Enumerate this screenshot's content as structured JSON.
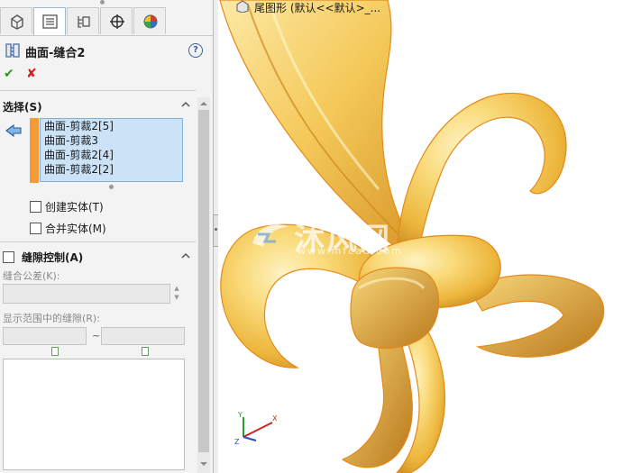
{
  "feature": {
    "title": "曲面-缝合2",
    "ok_label": "✔",
    "cancel_label": "✘",
    "help_label": "?"
  },
  "tabs": [
    {
      "icon": "feature-manager-icon"
    },
    {
      "icon": "property-manager-icon"
    },
    {
      "icon": "configuration-manager-icon"
    },
    {
      "icon": "dimxpert-manager-icon"
    },
    {
      "icon": "display-manager-icon"
    }
  ],
  "selection": {
    "header": "选择(S)",
    "items": [
      "曲面-剪裁2[5]",
      "曲面-剪裁3",
      "曲面-剪裁2[4]",
      "曲面-剪裁2[2]"
    ],
    "create_solid_label": "创建实体(T)",
    "merge_entities_label": "合并实体(M)"
  },
  "gap_control": {
    "header": "缝隙控制(A)",
    "knit_tolerance_label": "缝合公差(K):",
    "gap_range_label": "显示范围中的缝隙(R):",
    "range_separator": "~"
  },
  "viewport": {
    "tree_label": "尾图形  (默认<<默认>_..."
  },
  "watermark": {
    "text": "沐风网",
    "url": "www.mfcad.com"
  },
  "colors": {
    "accent": "#f59b34",
    "selection_bg": "#cce3f7",
    "model_gold": "#f2c64a",
    "model_edge": "#e58a1a"
  }
}
